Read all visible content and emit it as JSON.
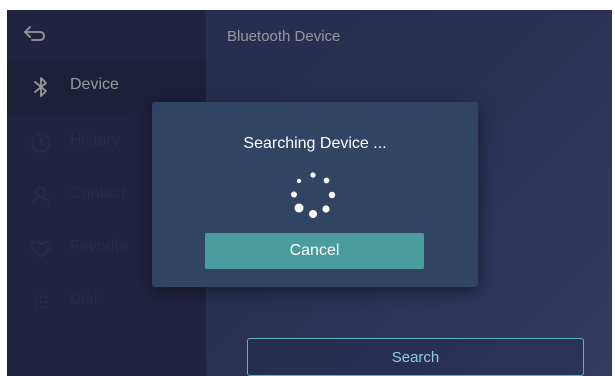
{
  "header": {
    "title": "Bluetooth Device",
    "back_icon": "back-arrow-icon"
  },
  "sidebar": {
    "items": [
      {
        "label": "Device",
        "icon": "bluetooth-icon",
        "active": true
      },
      {
        "label": "History",
        "icon": "clock-icon",
        "active": false
      },
      {
        "label": "Contact",
        "icon": "person-icon",
        "active": false
      },
      {
        "label": "Favorite",
        "icon": "heart-icon",
        "active": false
      },
      {
        "label": "Dial",
        "icon": "dialpad-icon",
        "active": false
      }
    ]
  },
  "main": {
    "search_label": "Search"
  },
  "dialog": {
    "title": "Searching Device ...",
    "spinner_icon": "loading-spinner-icon",
    "cancel_label": "Cancel"
  },
  "colors": {
    "accent_teal": "#4b9c9d",
    "sidebar_bg": "#2c2f52",
    "dialog_bg": "#324464",
    "search_border": "#5fb1bd"
  }
}
